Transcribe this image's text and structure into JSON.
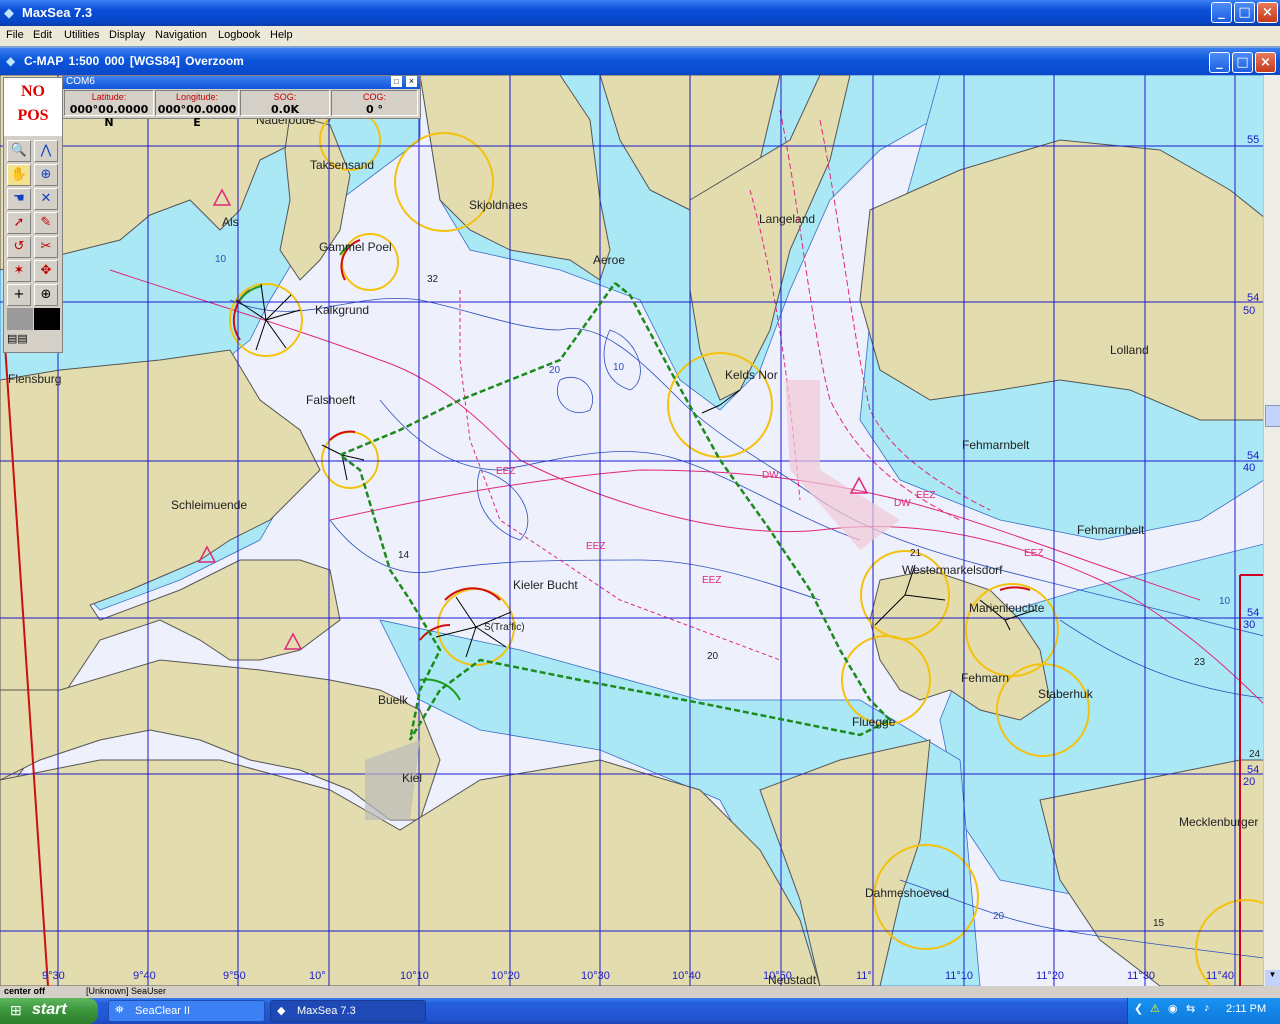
{
  "app": {
    "title": "MaxSea 7.3"
  },
  "menu": [
    "File",
    "Edit",
    "Utilities",
    "Display",
    "Navigation",
    "Logbook",
    "Help"
  ],
  "chart_window": {
    "title": "C-MAP  1:500 000 [WGS84]    Overzoom"
  },
  "toolbox": {
    "no_pos_line1": "NO",
    "no_pos_line2": "POS"
  },
  "gps": {
    "port": "COM6",
    "latitude_label": "Latitude:",
    "latitude_value": "000°00.0000 N",
    "longitude_label": "Longitude:",
    "longitude_value": "000°00.0000 E",
    "sog_label": "SOG:",
    "sog_value": "0.0K",
    "cog_label": "COG:",
    "cog_value": "0 °"
  },
  "places": {
    "naderodde": "Naderodde",
    "taksensand": "Taksensand",
    "als": "Als",
    "skjoldnaes": "Skjoldnaes",
    "gammel_poel": "Gammel Poel",
    "kalkgrund": "Kalkgrund",
    "aeroe": "Aeroe",
    "langeland": "Langeland",
    "flensburg": "Flensburg",
    "falshoeft": "Falshoeft",
    "keldsnor": "Kelds Nor",
    "lolland": "Lolland",
    "fehmarnbelt1": "Fehmarnbelt",
    "fehmarnbelt2": "Fehmarnbelt",
    "schleimuende": "Schleimuende",
    "westermarkelsdorf": "Westermarkelsdorf",
    "marienleuchte": "Marienleuchte",
    "kieler_bucht": "Kieler Bucht",
    "traffic": "S(Traffic)",
    "fehmarn": "Fehmarn",
    "staberhuk": "Staberhuk",
    "buelk": "Buelk",
    "fluegge": "Fluegge",
    "kiel": "Kiel",
    "dahmeshoeved": "Dahmeshoeved",
    "mecklenburger": "Mecklenburger",
    "neustadt": "Neustadt"
  },
  "chart_labels": {
    "eez": "EEZ",
    "dw": "DW",
    "d32": "32",
    "d14": "14",
    "d20": "20",
    "d24": "24",
    "d15": "15",
    "d23": "23",
    "d21": "21",
    "c10": "10",
    "c20": "20"
  },
  "lat_labels": [
    {
      "a": "55",
      "b": ""
    },
    {
      "a": "54",
      "b": "50"
    },
    {
      "a": "54",
      "b": "40"
    },
    {
      "a": "54",
      "b": "30"
    },
    {
      "a": "54",
      "b": "20"
    }
  ],
  "lon_labels": [
    "9°30",
    "9°40",
    "9°50",
    "10°",
    "10°10",
    "10°20",
    "10°30",
    "10°40",
    "10°50",
    "11°",
    "11°10",
    "11°20",
    "11°30",
    "11°40"
  ],
  "statusbar": {
    "left": "center off",
    "user": "[Unknown] SeaUser"
  },
  "taskbar": {
    "start": "start",
    "tasks": [
      "SeaClear II",
      "MaxSea 7.3"
    ],
    "clock": "2:11 PM"
  },
  "colors": {
    "land": "#e2dcae",
    "shallow": "#a9e8f4",
    "deep": "#eef0fb",
    "grid": "#1a1acc",
    "route": "#1d8a1d",
    "boundary": "#e0287a",
    "light_circle": "#f4c20d"
  }
}
